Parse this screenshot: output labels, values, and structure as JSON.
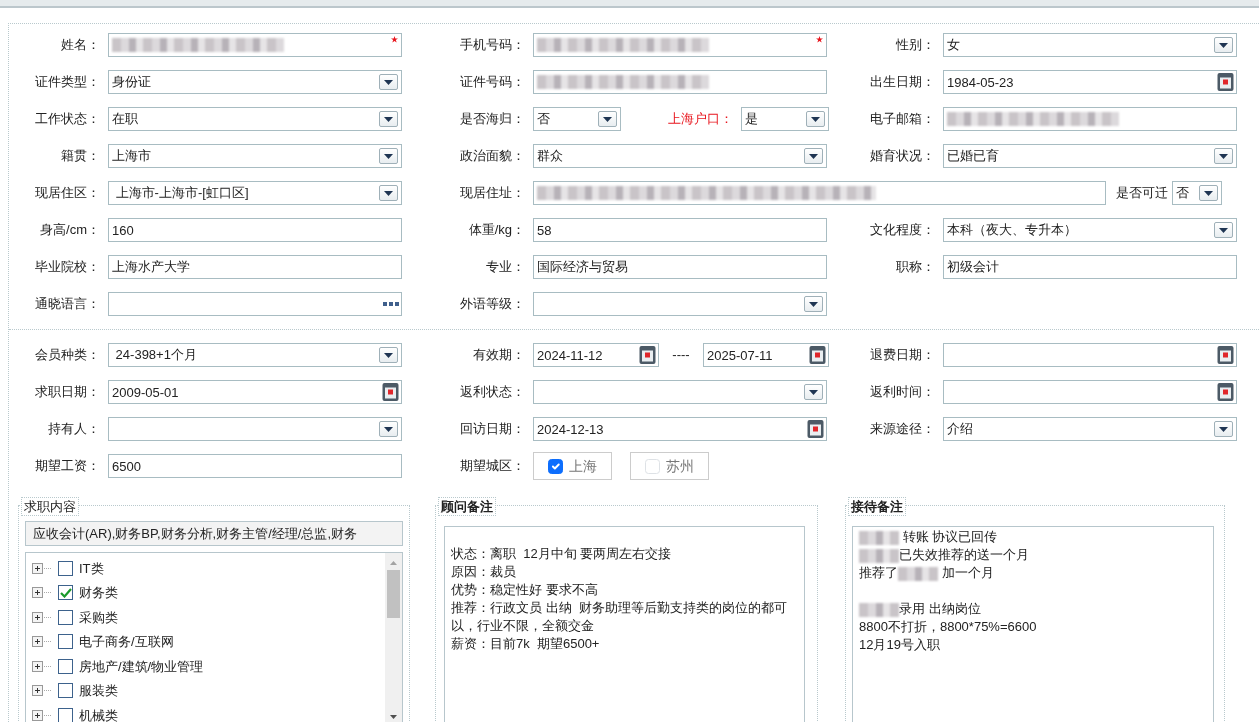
{
  "sections": [
    {
      "rows": [
        [
          {
            "items": [
              {
                "label": "姓名：",
                "field": {
                  "kind": "text",
                  "required": true,
                  "redacted": true
                }
              }
            ]
          },
          {
            "items": [
              {
                "label": "手机号码：",
                "field": {
                  "kind": "text",
                  "required": true,
                  "redacted": true
                }
              }
            ]
          },
          {
            "items": [
              {
                "label": "性别：",
                "field": {
                  "kind": "select",
                  "value": "女"
                }
              }
            ]
          }
        ],
        [
          {
            "items": [
              {
                "label": "证件类型：",
                "field": {
                  "kind": "select",
                  "value": "身份证"
                }
              }
            ]
          },
          {
            "items": [
              {
                "label": "证件号码：",
                "field": {
                  "kind": "text",
                  "required": false,
                  "redacted": true
                }
              }
            ]
          },
          {
            "items": [
              {
                "label": "出生日期：",
                "field": {
                  "kind": "date",
                  "value": "1984-05-23"
                }
              }
            ]
          }
        ],
        [
          {
            "items": [
              {
                "label": "工作状态：",
                "field": {
                  "kind": "select",
                  "value": "在职"
                }
              }
            ]
          },
          {
            "items": [
              {
                "label": "是否海归：",
                "emphasis": false,
                "field": {
                  "kind": "select",
                  "value": "否"
                }
              },
              {
                "label": "上海户口：",
                "emphasis": true,
                "field": {
                  "kind": "select",
                  "value": "是"
                }
              }
            ]
          },
          {
            "items": [
              {
                "label": "电子邮箱：",
                "field": {
                  "kind": "text",
                  "required": false,
                  "redacted": true
                }
              }
            ]
          }
        ],
        [
          {
            "items": [
              {
                "label": "籍贯：",
                "field": {
                  "kind": "select",
                  "value": "上海市"
                }
              }
            ]
          },
          {
            "items": [
              {
                "label": "政治面貌：",
                "field": {
                  "kind": "select",
                  "value": "群众"
                }
              }
            ]
          },
          {
            "items": [
              {
                "label": "婚育状况：",
                "field": {
                  "kind": "select",
                  "value": "已婚已育"
                }
              }
            ]
          }
        ],
        [
          {
            "items": [
              {
                "label": "现居住区：",
                "field": {
                  "kind": "select",
                  "value": " 上海市-上海市-[虹口区]"
                }
              }
            ]
          },
          {
            "items": [
              {
                "label": "现居住址：",
                "field": {
                  "kind": "text",
                  "required": false,
                  "redacted": true
                }
              },
              {
                "label": "是否可迁",
                "field": {
                  "kind": "select",
                  "value": "否"
                }
              }
            ]
          }
        ],
        [
          {
            "items": [
              {
                "label": "身高/cm：",
                "field": {
                  "kind": "text",
                  "value": "160",
                  "required": false,
                  "redacted": false
                }
              }
            ]
          },
          {
            "items": [
              {
                "label": "体重/kg：",
                "field": {
                  "kind": "text",
                  "value": "58",
                  "required": false,
                  "redacted": false
                }
              }
            ]
          },
          {
            "items": [
              {
                "label": "文化程度：",
                "field": {
                  "kind": "select",
                  "value": "本科（夜大、专升本）"
                }
              }
            ]
          }
        ],
        [
          {
            "items": [
              {
                "label": "毕业院校：",
                "field": {
                  "kind": "text",
                  "value": "上海水产大学",
                  "required": false,
                  "redacted": false
                }
              }
            ]
          },
          {
            "items": [
              {
                "label": "专业：",
                "field": {
                  "kind": "text",
                  "value": "国际经济与贸易",
                  "required": false,
                  "redacted": false
                }
              }
            ]
          },
          {
            "items": [
              {
                "label": "职称：",
                "field": {
                  "kind": "text",
                  "value": "初级会计",
                  "required": false,
                  "redacted": false
                }
              }
            ]
          }
        ],
        [
          {
            "items": [
              {
                "label": "通晓语言：",
                "field": {
                  "kind": "more"
                }
              }
            ]
          },
          {
            "items": [
              {
                "label": "外语等级：",
                "field": {
                  "kind": "select"
                }
              }
            ]
          }
        ]
      ]
    },
    {
      "rows": [
        [
          {
            "items": [
              {
                "label": "会员种类：",
                "field": {
                  "kind": "select",
                  "value": " 24-398+1个月"
                }
              }
            ]
          },
          {
            "items": [
              {
                "label": "有效期：",
                "field": {
                  "kind": "date",
                  "value": "2024-11-12"
                }
              },
              {
                "label": "----",
                "field": {
                  "kind": "date",
                  "value": "2025-07-11"
                }
              }
            ]
          },
          {
            "items": [
              {
                "label": "退费日期：",
                "field": {
                  "kind": "date"
                }
              }
            ]
          }
        ],
        [
          {
            "items": [
              {
                "label": "求职日期：",
                "field": {
                  "kind": "date",
                  "value": "2009-05-01"
                }
              }
            ]
          },
          {
            "items": [
              {
                "label": "返利状态：",
                "field": {
                  "kind": "select"
                }
              }
            ]
          },
          {
            "items": [
              {
                "label": "返利时间：",
                "field": {
                  "kind": "date"
                }
              }
            ]
          }
        ],
        [
          {
            "items": [
              {
                "label": "持有人：",
                "field": {
                  "kind": "select"
                }
              }
            ]
          },
          {
            "items": [
              {
                "label": "回访日期：",
                "field": {
                  "kind": "date",
                  "value": "2024-12-13"
                }
              }
            ]
          },
          {
            "items": [
              {
                "label": "来源途径：",
                "field": {
                  "kind": "select",
                  "value": "介绍"
                }
              }
            ]
          }
        ],
        [
          {
            "items": [
              {
                "label": "期望工资：",
                "field": {
                  "kind": "text",
                  "value": "6500",
                  "required": false,
                  "redacted": false
                }
              }
            ]
          },
          {
            "items": [
              {
                "label": "期望城区：",
                "field": {
                  "kind": "checks",
                  "options": [
                    {
                      "label": "上海",
                      "checked": true
                    },
                    {
                      "label": "苏州",
                      "checked": false
                    }
                  ]
                }
              }
            ]
          }
        ]
      ]
    }
  ],
  "job_content": {
    "title": "求职内容",
    "value": "应收会计(AR),财务BP,财务分析,财务主管/经理/总监,财务",
    "categories": [
      {
        "label": "IT类",
        "checked": false,
        "expanded": false
      },
      {
        "label": "财务类",
        "checked": true,
        "expanded": false
      },
      {
        "label": "采购类",
        "checked": false,
        "expanded": false
      },
      {
        "label": "电子商务/互联网",
        "checked": false,
        "expanded": false
      },
      {
        "label": "房地产/建筑/物业管理",
        "checked": false,
        "expanded": false
      },
      {
        "label": "服装类",
        "checked": false,
        "expanded": false
      },
      {
        "label": "机械类",
        "checked": false,
        "expanded": false
      }
    ]
  },
  "advisor_notes": {
    "title": "顾问备注",
    "paragraphs": [
      [
        [
          {
            "kind": "text",
            "text": "状态：离职  12月中旬 要两周左右交接"
          }
        ],
        [
          {
            "kind": "text",
            "text": "原因：裁员"
          }
        ],
        [
          {
            "kind": "text",
            "text": "优势：稳定性好 要求不高"
          }
        ],
        [
          {
            "kind": "text",
            "text": "推荐：行政文员 出纳  财务助理等后勤支持类的岗位的都可以，行业不限，全额交金"
          }
        ],
        [
          {
            "kind": "text",
            "text": "薪资：目前7k  期望6500+"
          }
        ]
      ]
    ]
  },
  "reception_notes": {
    "title": "接待备注",
    "paragraphs": [
      [
        [
          {
            "kind": "redacted"
          },
          {
            "kind": "text",
            "text": " 转账 协议已回传"
          }
        ],
        [
          {
            "kind": "redacted"
          },
          {
            "kind": "text",
            "text": "已失效推荐的送一个月"
          }
        ],
        [
          {
            "kind": "text",
            "text": "推荐了"
          },
          {
            "kind": "redacted"
          },
          {
            "kind": "text",
            "text": " 加一个月"
          }
        ]
      ],
      [
        [
          {
            "kind": "redacted"
          },
          {
            "kind": "text",
            "text": "录用 出纳岗位"
          }
        ],
        [
          {
            "kind": "text",
            "text": "8800不打折，8800*75%=6600"
          }
        ],
        [
          {
            "kind": "text",
            "text": "12月19号入职"
          }
        ]
      ]
    ]
  }
}
